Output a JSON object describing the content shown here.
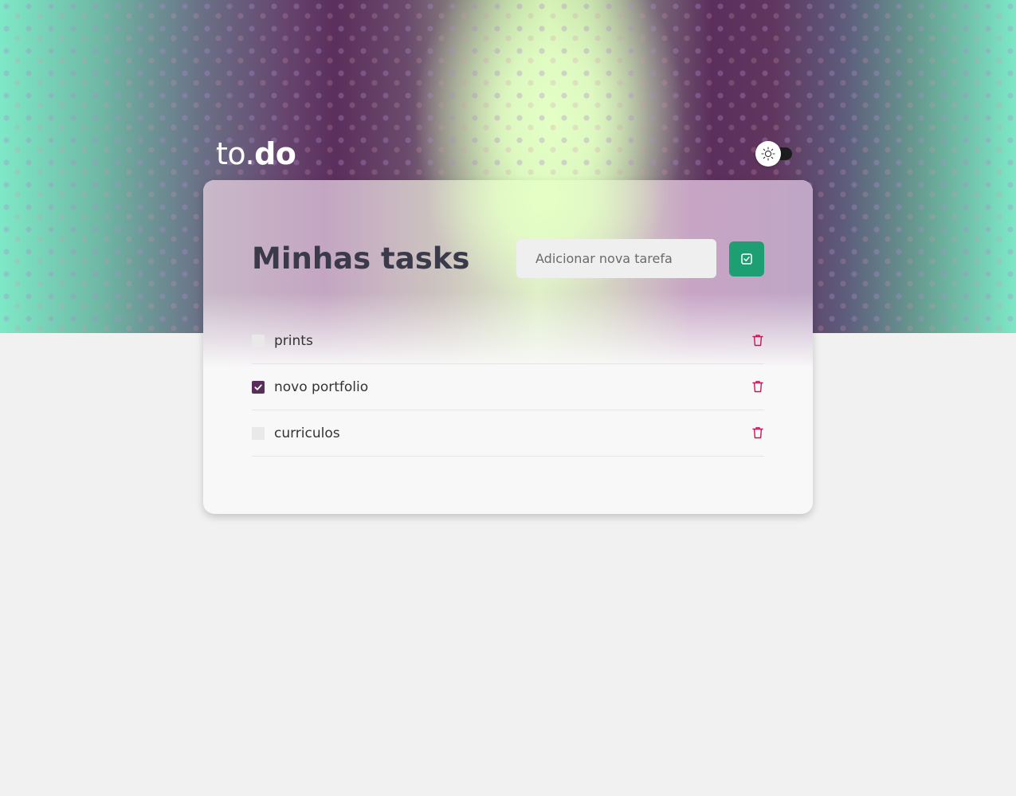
{
  "header": {
    "logo_prefix": "to.",
    "logo_suffix": "do",
    "theme_toggle": {
      "icon": "sun-icon",
      "state": "light"
    }
  },
  "main": {
    "title": "Minhas tasks",
    "new_task_placeholder": "Adicionar nova tarefa",
    "add_button_icon": "check-square-icon",
    "tasks": [
      {
        "label": "prints",
        "done": false
      },
      {
        "label": "novo portfolio",
        "done": true
      },
      {
        "label": "curriculos",
        "done": false
      }
    ]
  },
  "colors": {
    "accent_green": "#1e9e73",
    "checked_purple": "#5a2e5a",
    "delete_red": "#c2185b",
    "title_text": "#3b3a4a"
  }
}
